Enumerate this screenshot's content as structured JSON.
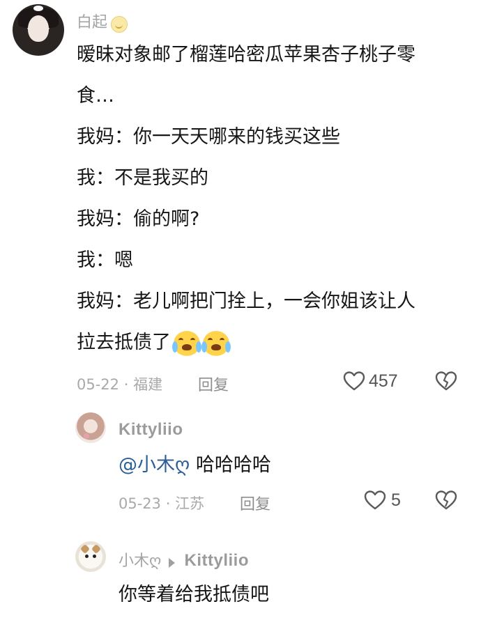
{
  "comment": {
    "username": "白起",
    "lines": [
      "暧昧对象邮了榴莲哈密瓜苹果杏子桃子零",
      "食…",
      "我妈：你一天天哪来的钱买这些",
      "我：不是我买的",
      "我妈：偷的啊?",
      "我：嗯",
      "我妈：老儿啊把门拴上，一会你姐该让人",
      "拉去抵债了"
    ],
    "date": "05-22",
    "location": "福建",
    "reply_label": "回复",
    "likes": "457",
    "icons": [
      "smile-emoji-icon",
      "crying-emoji-icon",
      "heart-icon",
      "broken-heart-icon"
    ]
  },
  "reply1": {
    "username": "Kittyliio",
    "mention": "@小木ღ",
    "text": "哈哈哈哈",
    "date": "05-23",
    "location": "江苏",
    "reply_label": "回复",
    "likes": "5"
  },
  "reply2": {
    "username": "小木ღ",
    "reply_to": "Kittyliio",
    "text": "你等着给我抵债吧"
  },
  "colors": {
    "mention": "#2c5e98",
    "meta": "#a9a9a9",
    "text": "#161616"
  }
}
